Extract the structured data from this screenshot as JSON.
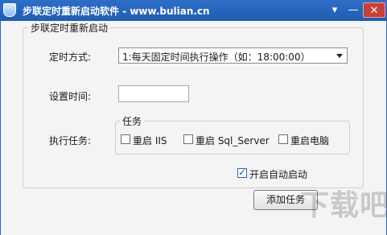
{
  "window": {
    "title": "步联定时重新启动软件 - www.bulian.cn",
    "menu_glyph": "▾",
    "minimize_glyph": "—",
    "close_glyph": "✕"
  },
  "group_main": {
    "legend": "步联定时重新启动"
  },
  "form": {
    "schedule_label": "定时方式:",
    "schedule_value": "1:每天固定时间执行操作（如：18:00:00）",
    "time_label": "设置时间:",
    "time_value": "",
    "task_label": "执行任务:"
  },
  "tasks": {
    "legend": "任务",
    "items": [
      {
        "label": "重启 IIS",
        "checked": false
      },
      {
        "label": "重启 Sql_Server",
        "checked": false
      },
      {
        "label": "重启电脑",
        "checked": false
      }
    ]
  },
  "autostart": {
    "label": "开启自动启动",
    "checked": true,
    "check_glyph": "✓"
  },
  "actions": {
    "add_task": "添加任务"
  },
  "watermark": {
    "text": "下载吧"
  }
}
